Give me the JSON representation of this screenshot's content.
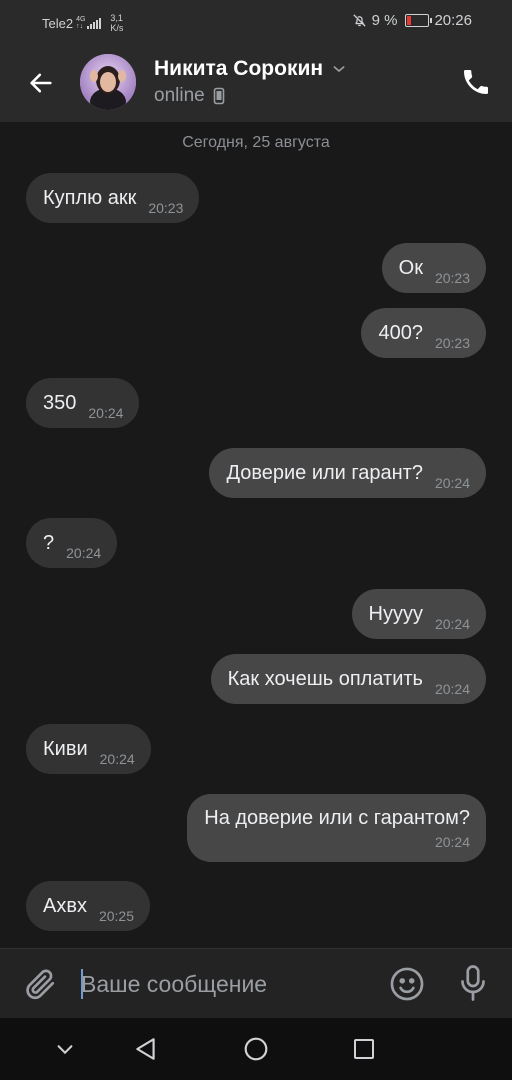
{
  "status_bar": {
    "carrier": "Tele2",
    "network_type": "4G",
    "network_sub": "↑↓",
    "speed_value": "3,1",
    "speed_unit": "K/s",
    "battery_text": "9 %",
    "battery_level_percent": 9,
    "time": "20:26",
    "icons": [
      "signal-icon",
      "mute-icon",
      "battery-icon"
    ]
  },
  "header": {
    "contact_name": "Никита Сорокин",
    "presence": "online",
    "icons": [
      "back-arrow-icon",
      "chevron-down-icon",
      "mobile-device-icon",
      "phone-icon"
    ]
  },
  "chat": {
    "date_separator": "Сегодня, 25 августа",
    "messages": [
      {
        "dir": "in",
        "text": "Куплю акк",
        "time": "20:23"
      },
      {
        "dir": "out",
        "text": "Ок",
        "time": "20:23"
      },
      {
        "dir": "out",
        "text": "400?",
        "time": "20:23"
      },
      {
        "dir": "in",
        "text": "350",
        "time": "20:24"
      },
      {
        "dir": "out",
        "text": "Доверие или гарант?",
        "time": "20:24"
      },
      {
        "dir": "in",
        "text": "?",
        "time": "20:24"
      },
      {
        "dir": "out",
        "text": "Нуууу",
        "time": "20:24"
      },
      {
        "dir": "out",
        "text": "Как хочешь оплатить",
        "time": "20:24"
      },
      {
        "dir": "in",
        "text": "Киви",
        "time": "20:24"
      },
      {
        "dir": "out",
        "text": "На доверие или с гарантом?",
        "time": "20:24"
      },
      {
        "dir": "in",
        "text": "Ахвх",
        "time": "20:25"
      }
    ]
  },
  "composer": {
    "placeholder": "Ваше сообщение",
    "value": "",
    "icons": [
      "paperclip-icon",
      "emoji-icon",
      "microphone-icon"
    ]
  },
  "nav_bar": {
    "icons": [
      "nav-hide-icon",
      "nav-back-icon",
      "nav-home-icon",
      "nav-recents-icon"
    ]
  },
  "colors": {
    "background": "#191919",
    "header": "#2a2a2a",
    "bubble_in": "#333333",
    "bubble_out": "#474747",
    "cursor": "#6f9bd1",
    "battery_low": "#e53935"
  }
}
